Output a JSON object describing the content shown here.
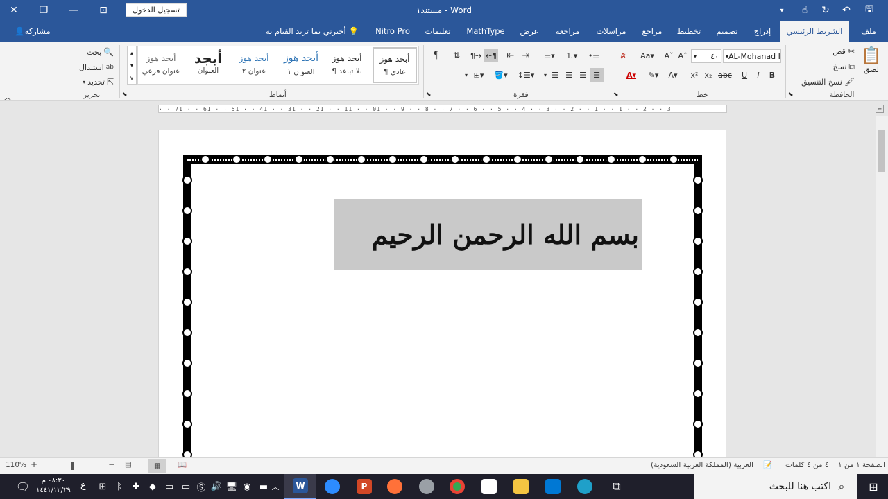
{
  "titlebar": {
    "doc_title": "مستند١ - Word",
    "signin": "تسجيل الدخول"
  },
  "tabs": {
    "file": "ملف",
    "home": "الشريط الرئيسي",
    "insert": "إدراج",
    "design": "تصميم",
    "layout": "تخطيط",
    "references": "مراجع",
    "mailings": "مراسلات",
    "review": "مراجعة",
    "view": "عرض",
    "mathtype": "MathType",
    "help": "تعليمات",
    "nitro": "Nitro Pro",
    "tellme": "أخبرني بما تريد القيام به",
    "share": "مشاركة"
  },
  "ribbon": {
    "clipboard": {
      "label": "الحافظة",
      "paste": "لصق",
      "cut": "قص",
      "copy": "نسخ",
      "format_painter": "نسخ التنسيق"
    },
    "font": {
      "label": "خط",
      "name": "AL-Mohanad I",
      "size": "٤٠"
    },
    "paragraph": {
      "label": "فقرة"
    },
    "styles": {
      "label": "أنماط",
      "items": [
        {
          "sample": "أبجد هوز",
          "name": "¶ عادي"
        },
        {
          "sample": "أبجد هوز",
          "name": "¶ بلا تباعد"
        },
        {
          "sample": "أبجد هوز",
          "name": "العنوان ١"
        },
        {
          "sample": "أبجد هوز",
          "name": "عنوان ٢"
        },
        {
          "sample": "أبجد",
          "name": "العنوان"
        },
        {
          "sample": "أبجد هوز",
          "name": "عنوان فرعي"
        }
      ]
    },
    "editing": {
      "label": "تحرير",
      "find": "بحث",
      "replace": "استبدال",
      "select": "تحديد"
    }
  },
  "ruler": {
    "ticks": "· · 71 · · 61 · · 51 · · 41 · · 31 · · 21 · · 11 · · 01 · · 9 · · 8 · · 7 · · 6 · · 5 · · 4 · · 3 · · 2 · · 1 · · 1 · · 2 · · 3"
  },
  "document": {
    "heading": "بسم الله الرحمن الرحيم"
  },
  "statusbar": {
    "page": "الصفحة ١ من ١",
    "words": "٤ من ٤ كلمات",
    "language": "العربية (المملكة العربية السعودية)",
    "zoom": "110%"
  },
  "taskbar": {
    "search_placeholder": "اكتب هنا للبحث",
    "time": "٠٨:٣٠ م",
    "date": "١٤٤١/١٢/٢٩",
    "lang": "ع"
  },
  "colors": {
    "word_blue": "#2b579a",
    "taskbar": "#1f1f2b"
  }
}
